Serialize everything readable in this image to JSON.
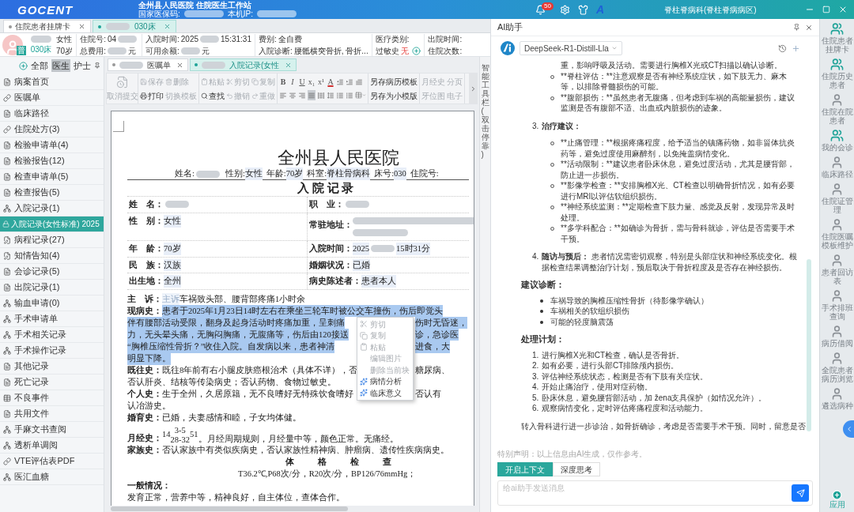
{
  "header": {
    "logo": "GOCENT",
    "title": "全州县人民医院 住院医生工作站",
    "subtitle_fields": [
      {
        "label": "国家医保码:",
        "masked": true
      },
      {
        "label": "本机IP:",
        "masked": true
      }
    ],
    "notification_count": "50",
    "user_initial": "A",
    "department": "脊柱脊病科(脊柱脊病病区)"
  },
  "patient_tabs": [
    {
      "label": "住院患者挂牌卡",
      "selected": false
    },
    {
      "label": "030床",
      "masked": true,
      "selected": true
    }
  ],
  "patient": {
    "name_masked": true,
    "avatar_badge": "普",
    "bed": "030床",
    "gender": "女性",
    "age": "70岁",
    "fields": [
      [
        {
          "label": "住院号:",
          "value": "04",
          "masked": true
        },
        {
          "label": "总费用:",
          "masked": true,
          "suffix": "元"
        }
      ],
      [
        {
          "label": "入院时间:",
          "value": "2025",
          "masked": true,
          "suffix": "15:31:31"
        },
        {
          "label": "可用余额:",
          "masked": true,
          "suffix": "元"
        }
      ],
      [
        {
          "label": "费别:",
          "value": "全自费"
        },
        {
          "label": "入院诊断:",
          "value": "腰骶横突骨折, 骨折..."
        }
      ],
      [
        {
          "label": "医疗类别:"
        },
        {
          "label": "过敏史",
          "value": "无",
          "alert": true
        }
      ],
      [
        {
          "label": "出院时间:"
        },
        {
          "label": "住院次数:"
        }
      ]
    ]
  },
  "record_filter": [
    {
      "label": "全部",
      "selected": false
    },
    {
      "label": "医生",
      "selected": true
    },
    {
      "label": "护士",
      "selected": false
    }
  ],
  "records": [
    {
      "label": "病案首页",
      "kind": "doc",
      "selected": false
    },
    {
      "label": "医嘱单",
      "kind": "link",
      "selected": false
    },
    {
      "label": "临床路径",
      "kind": "doc",
      "selected": false
    },
    {
      "label": "住院处方(3)",
      "kind": "link",
      "selected": false
    },
    {
      "label": "检验申请单(4)",
      "kind": "doc",
      "selected": false
    },
    {
      "label": "检验报告(12)",
      "kind": "doc",
      "selected": false
    },
    {
      "label": "检查申请单(5)",
      "kind": "doc",
      "selected": false
    },
    {
      "label": "检查报告(5)",
      "kind": "doc",
      "selected": false
    },
    {
      "label": "入院记录(1)",
      "kind": "folder",
      "selected": false,
      "expanded": true,
      "children": [
        {
          "label": "入院记录(女性标准)",
          "date": "2025",
          "kind": "locked",
          "selected": true
        }
      ]
    },
    {
      "label": "病程记录(27)",
      "kind": "edit",
      "selected": false
    },
    {
      "label": "知情告知(4)",
      "kind": "edit",
      "selected": false
    },
    {
      "label": "会诊记录(5)",
      "kind": "doc",
      "selected": false
    },
    {
      "label": "出院记录(1)",
      "kind": "doc",
      "selected": false
    },
    {
      "label": "输血申请(0)",
      "kind": "folder",
      "selected": false
    },
    {
      "label": "手术申请单",
      "kind": "folder",
      "selected": false
    },
    {
      "label": "手术相关记录",
      "kind": "folder",
      "selected": false
    },
    {
      "label": "手术操作记录",
      "kind": "folder",
      "selected": false
    },
    {
      "label": "其他记录",
      "kind": "doc",
      "selected": false
    },
    {
      "label": "死亡记录",
      "kind": "doc",
      "selected": false
    },
    {
      "label": "不良事件",
      "kind": "grid",
      "selected": false
    },
    {
      "label": "共用文件",
      "kind": "doc",
      "selected": false
    },
    {
      "label": "手麻文书查阅",
      "kind": "folder",
      "selected": false
    },
    {
      "label": "透析单调阅",
      "kind": "folder",
      "selected": false
    },
    {
      "label": "VTE评估表PDF",
      "kind": "link",
      "selected": false
    },
    {
      "label": "医汇血糖",
      "kind": "folder",
      "selected": false
    }
  ],
  "doc_tabs": [
    {
      "label": "医嘱单",
      "masked": true,
      "selected": false
    },
    {
      "label": "入院记录(女性",
      "masked": true,
      "selected": true
    }
  ],
  "toolbar": {
    "submit": {
      "label": "取消提交",
      "disabled": true
    },
    "groups": [
      {
        "rows": [
          [
            {
              "kind": "save",
              "label": "保存",
              "disabled": true
            },
            {
              "kind": "delete",
              "label": "删除",
              "disabled": true
            }
          ],
          [
            {
              "kind": "print",
              "label": "打印",
              "disabled": false
            },
            {
              "kind": "plain",
              "label": "切换模板",
              "disabled": true
            }
          ]
        ]
      },
      {
        "rows": [
          [
            {
              "kind": "paste",
              "label": "粘贴",
              "disabled": true
            },
            {
              "kind": "cut",
              "label": "剪切",
              "disabled": true
            },
            {
              "kind": "copy",
              "label": "复制",
              "disabled": true
            }
          ],
          [
            {
              "kind": "find",
              "label": "查找",
              "disabled": false
            },
            {
              "kind": "undo",
              "label": "撤销",
              "disabled": true
            },
            {
              "kind": "redo",
              "label": "重做",
              "disabled": true
            }
          ]
        ]
      },
      {
        "rows": [
          [
            {
              "kind": "bold",
              "label": "B"
            },
            {
              "kind": "italic",
              "label": "I"
            },
            {
              "kind": "underline",
              "label": "U"
            },
            {
              "kind": "script",
              "label": "x₁"
            },
            {
              "kind": "script",
              "label": "x¹"
            },
            {
              "kind": "font-color",
              "label": "A"
            },
            {
              "kind": "outdent"
            },
            {
              "kind": "indent"
            },
            {
              "kind": "first-indent"
            }
          ],
          [
            {
              "kind": "align-left",
              "selected": false
            },
            {
              "kind": "align-center",
              "selected": false
            },
            {
              "kind": "align-right",
              "selected": false
            },
            {
              "kind": "justify",
              "selected": true
            },
            {
              "kind": "distribute",
              "selected": false
            },
            {
              "kind": "line-spacing"
            },
            {
              "kind": "bullets"
            },
            {
              "kind": "numbering"
            },
            {
              "kind": "table"
            }
          ]
        ]
      },
      {
        "rows": [
          [
            {
              "kind": "plain",
              "label": "另存病历模板",
              "disabled": false
            }
          ],
          [
            {
              "kind": "plain",
              "label": "另存为小模版",
              "disabled": false
            }
          ]
        ]
      },
      {
        "rows": [
          [
            {
              "kind": "plain",
              "label": "月经史",
              "disabled": true
            },
            {
              "kind": "plain",
              "label": "分页",
              "disabled": true
            }
          ],
          [
            {
              "kind": "plain",
              "label": "牙位图",
              "disabled": true
            },
            {
              "kind": "plain",
              "label": "电子",
              "disabled": true
            }
          ]
        ]
      }
    ]
  },
  "document": {
    "title": "全州县人民医院",
    "header_fields": [
      {
        "label": "姓名:",
        "masked": true
      },
      {
        "label": "性别:",
        "value": "女性"
      },
      {
        "label": "年龄:",
        "value": "70岁"
      },
      {
        "label": "科室:",
        "value": "脊柱骨病科"
      },
      {
        "label": "床号:",
        "value": "030"
      },
      {
        "label": "住院号:"
      }
    ],
    "record_title": "入 院 记 录",
    "info_rows": [
      [
        {
          "label": "姓　名：",
          "masked": true
        },
        {
          "label": "职　业：",
          "masked": true
        }
      ],
      [
        {
          "label": "性　别：",
          "value": "女性"
        },
        {
          "label": "常驻地址：",
          "masked": true,
          "multiline": true
        }
      ],
      [
        {
          "label": "年　龄：",
          "value": "70岁"
        },
        {
          "label": "入院时间：",
          "value": "2025",
          "masked": true,
          "suffix": "15时31分"
        }
      ],
      [
        {
          "label": "民　族：",
          "value": "汉族"
        },
        {
          "label": "婚姻状况：",
          "value": "已婚"
        }
      ],
      [
        {
          "label": "出生地：",
          "value": "全州"
        },
        {
          "label": "病史陈述者：",
          "value": "患者本人"
        }
      ]
    ],
    "body_lines": [
      {
        "kind": "text",
        "label": "主　诉：",
        "hint": "主诉",
        "text": "车祸致头部、腰背部疼痛1小时余",
        "highlighted": false
      },
      {
        "kind": "text",
        "label": "现病史：",
        "text": "患者于2025年1月23日14时左右在乘坐三轮车时被公交车撞伤，伤后即觉头",
        "highlighted": true
      },
      {
        "kind": "menu_band",
        "lines": [
          {
            "kind": "text",
            "text": "伴有腰部活动受限，翻身及起身活动时疼痛加重，呈刺痛",
            "after_menu": "伤时无昏迷，",
            "highlighted": true
          },
          {
            "kind": "text",
            "text": "力，无头晕头痛，无胸闷胸痛，无腹痛等，伤后由120接送",
            "after_menu": "诊，急诊医",
            "highlighted": true
          },
          {
            "kind": "text",
            "text": "“胸椎压缩性骨折？”收住入院。自发病以来，患者神清",
            "after_menu": "进食，大",
            "highlighted": true
          },
          {
            "kind": "text",
            "text": "明显下降。",
            "highlighted": true
          },
          {
            "kind": "text",
            "label": "既往史：",
            "text": "既往8年前有右小腿皮肤癌根治术（具体不详），否",
            "after_menu": "糖尿病、",
            "highlighted": false
          },
          {
            "kind": "text",
            "text": "否认肝炎、结核等传染病史；否认药物、食物过敏史。",
            "highlighted": false
          },
          {
            "kind": "text",
            "label": "个人史：",
            "text": "生于全州，久居原籍，无不良嗜好无特殊饮食嗜好",
            "after_menu": "否认有",
            "highlighted": false
          }
        ]
      },
      {
        "kind": "text",
        "text": "认冶游史。",
        "highlighted": false
      },
      {
        "kind": "text",
        "label": "婚育史：",
        "text": "已婚，夫妻感情和睦，子女均体健。",
        "highlighted": false
      },
      {
        "kind": "formula",
        "label": "月经史：",
        "menarche": "14",
        "period": "3-5",
        "cycle": "28-32",
        "menopause": "51",
        "text": "。月经周期规则，月经量中等，颜色正常。无痛经。",
        "highlighted": false
      },
      {
        "kind": "text",
        "label": "家族史：",
        "text": "否认家族中有类似疾病史，否认家族性精神病、肿瘤病、遗传性疾病病史。",
        "highlighted": false
      },
      {
        "kind": "heading",
        "text": "体格检查",
        "highlighted": false
      },
      {
        "kind": "centered",
        "text": "T36.2℃,P68次/分，R20次/分，BP126/76mmHg；",
        "highlighted": false
      },
      {
        "kind": "text",
        "label": "一般情况：",
        "highlighted": false
      },
      {
        "kind": "text",
        "text": "发育正常，营养中等，精神良好，自主体位，查体合作。",
        "highlighted": false
      }
    ]
  },
  "context_menu": [
    {
      "label": "剪切",
      "kind": "cut",
      "disabled": true
    },
    {
      "label": "复制",
      "kind": "copy",
      "disabled": true
    },
    {
      "label": "粘贴",
      "kind": "paste",
      "disabled": true
    },
    {
      "label": "编辑图片",
      "kind": "plain",
      "disabled": true
    },
    {
      "label": "删除当前块",
      "kind": "plain",
      "disabled": true
    },
    {
      "label": "病情分析",
      "kind": "ai",
      "disabled": false
    },
    {
      "label": "临床意义",
      "kind": "ai",
      "disabled": false
    }
  ],
  "side_strip": "智能工具栏(双击停靠)",
  "ai_panel": {
    "title": "AI助手",
    "model": "DeepSeek-R1-Distill-Lla",
    "blocks": [
      {
        "kind": "continuation",
        "text": "重，影响呼吸及活动。需要进行胸椎X光或CT扫描以确认诊断。"
      },
      {
        "kind": "sub_bullet",
        "text": "**脊柱评估：**注意观察是否有神经系统症状，如下肢无力、麻木等，以排除脊髓损伤的可能。"
      },
      {
        "kind": "sub_bullet",
        "text": "**腹部损伤：**虽然患者无腹痛，但考虑到车祸的高能量损伤，建议监测是否有腹部不适、出血或内脏损伤的迹象。"
      },
      {
        "kind": "numbered",
        "number": "3.",
        "title": "治疗建议："
      },
      {
        "kind": "sub_bullet",
        "text": "**止痛管理：**根据疼痛程度，给予适当的镇痛药物，如非甾体抗炎药等，避免过度使用麻醉剂，以免掩盖病情变化。"
      },
      {
        "kind": "sub_bullet",
        "text": "**活动限制：**建议患者卧床休息，避免过度活动，尤其是腰背部，防止进一步损伤。"
      },
      {
        "kind": "sub_bullet",
        "text": "**影像学检查：**安排胸椎X光、CT检查以明确骨折情况，如有必要进行MRI以评估软组织损伤。"
      },
      {
        "kind": "sub_bullet",
        "text": "**神经系统监测：**定期检查下肢力量、感觉及反射，发现异常及时处理。"
      },
      {
        "kind": "sub_bullet",
        "text": "**多学科配合：**如确诊为骨折，需与骨科就诊，评估是否需要手术干预。"
      },
      {
        "kind": "numbered",
        "number": "4.",
        "title": "随访与预后：",
        "text": "患者情况需密切观察，特别是头部症状和神经系统变化。根据检查结果调整治疗计划，预后取决于骨折程度及是否存在神经损伤。"
      },
      {
        "kind": "heading",
        "text": "建议诊断："
      },
      {
        "kind": "bullet",
        "text": "车祸导致的胸椎压缩性骨折（待影像学确认）"
      },
      {
        "kind": "bullet",
        "text": "车祸相关的软组织损伤"
      },
      {
        "kind": "bullet",
        "text": "可能的轻度脑震荡"
      },
      {
        "kind": "heading",
        "text": "处理计划："
      },
      {
        "kind": "ordered",
        "number": "1.",
        "text": "进行胸椎X光和CT检查，确认是否骨折。"
      },
      {
        "kind": "ordered",
        "number": "2.",
        "text": "如有必要，进行头部CT排除颅内损伤。"
      },
      {
        "kind": "ordered",
        "number": "3.",
        "text": "评估神经系统状态，检测是否有下肢有关症状。"
      },
      {
        "kind": "ordered",
        "number": "4.",
        "text": "开始止痛治疗，使用对症药物。"
      },
      {
        "kind": "ordered",
        "number": "5.",
        "text": "卧床休息，避免腰背部活动，加 žena支具保护（如情况允许）。"
      },
      {
        "kind": "ordered",
        "number": "6.",
        "text": "观察病情变化，定时评估疼痛程度和活动能力。"
      },
      {
        "kind": "paragraph",
        "text": "转入骨科进行进一步诊治，如骨折确诊，考虑是否需要手术干预。同时，留意是否"
      }
    ],
    "disclaimer": "特别声明：以上信息由AI生成，仅作参考。",
    "modes": [
      {
        "label": "开启上下文",
        "selected": true
      },
      {
        "label": "深度思考",
        "selected": false
      }
    ],
    "input": {
      "placeholder": "给ai助手发送消息"
    }
  },
  "right_sidebar": {
    "items": [
      {
        "label": "住院患者挂牌卡",
        "kind": "group"
      },
      {
        "label": "住院历史患者",
        "kind": "group"
      },
      {
        "label": "住院在院患者",
        "kind": "person"
      },
      {
        "label": "我的会诊",
        "kind": "group"
      },
      {
        "label": "临床路径",
        "kind": "person"
      },
      {
        "label": "住院证管理",
        "kind": "person"
      },
      {
        "label": "住院医嘱模板维护",
        "kind": "person"
      },
      {
        "label": "患者回访表",
        "kind": "person"
      },
      {
        "label": "手术排班查询",
        "kind": "person"
      },
      {
        "label": "病历借阅",
        "kind": "person"
      },
      {
        "label": "全院患者病历浏览",
        "kind": "person"
      },
      {
        "label": "遴选病种",
        "kind": "person"
      }
    ],
    "app_label": "应用"
  }
}
